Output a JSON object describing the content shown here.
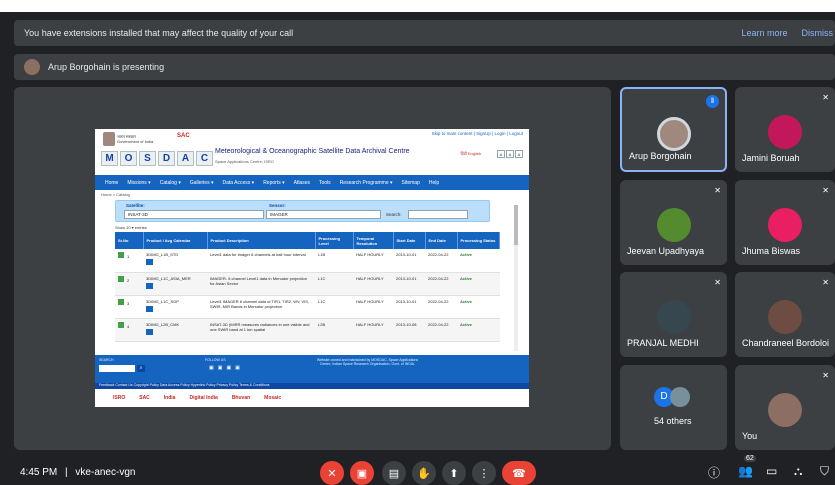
{
  "banner": {
    "text": "You have extensions installed that may affect the quality of your call",
    "learn_more": "Learn more",
    "dismiss": "Dismiss"
  },
  "presenting": {
    "text": "Arup Borgohain is presenting"
  },
  "mosdac": {
    "goi_hindi": "भारत सरकार",
    "goi": "Government of India",
    "sac": "SAC",
    "letters": [
      "M",
      "O",
      "S",
      "D",
      "A",
      "C"
    ],
    "title": "Meteorological & Oceanographic Satellite Data Archival Centre",
    "subtitle": "Space Applications Centre, ISRO",
    "skip": "Skip to main content | SignUp | Login | Logout",
    "lang": "हिंदी  English",
    "nav": [
      "Home",
      "Missions ▾",
      "Catalog ▾",
      "Galleries ▾",
      "Data Access ▾",
      "Reports ▾",
      "Atlases",
      "Tools",
      "Research Programme ▾",
      "Sitemap",
      "Help"
    ],
    "breadcrumb": "Home » Catalog",
    "satellite_label": "Satellite:",
    "satellite_value": "INSAT-3D",
    "sensor_label": "Sensor:",
    "sensor_value": "IMAGER",
    "search_label": "Search:",
    "show": "Show 10 ▾ entries",
    "columns": [
      "Sr.No",
      "Product / Avg Calendar",
      "Product Description",
      "Processing Level",
      "Temporal Resolution",
      "Start Date",
      "End Date",
      "Processing Status"
    ],
    "rows": [
      {
        "no": "1",
        "product": "3DIMG_L1B_STD",
        "desc": "Level1 data for Imager 6 channels at half hour interval",
        "level": "L1B",
        "temporal": "HALF HOURLY",
        "start": "2013-10-01",
        "end": "2022-04-22",
        "status": "Active"
      },
      {
        "no": "2",
        "product": "3DIMG_L1C_ASIA_MER",
        "desc": "IMAGER- 6 channel Level1 data in Mercator projection for Asian Sector",
        "level": "L1C",
        "temporal": "HALF HOURLY",
        "start": "2013-10-01",
        "end": "2022-04-22",
        "status": "Active"
      },
      {
        "no": "3",
        "product": "3DIMG_L1C_SGP",
        "desc": "Level1 IMAGER 6 channel data of TIR1, TIR2, WV, VIS, SWIR, MIR Bands in Mercator projection",
        "level": "L1C",
        "temporal": "HALF HOURLY",
        "start": "2013-10-01",
        "end": "2022-04-22",
        "status": "Active"
      },
      {
        "no": "4",
        "product": "3DIMG_L2B_CMK",
        "desc": "INSAT-3D (IMRR measures radiances in one visible and one SWIR band at 1 km spatial",
        "level": "L2B",
        "temporal": "HALF HOURLY",
        "start": "2013-10-08",
        "end": "2022-04-22",
        "status": "Active"
      }
    ],
    "footer_search": "SEARCH",
    "footer_follow": "FOLLOW US",
    "footer_site": "Website owned and maintained by MOSDAC, Space Applications Centre, Indian Space Research Organisation, Govt. of INDIA.",
    "footer_links": "Feedback   Contact Us   Copyright Policy   Data Access Policy   Hyperlink Policy   Privacy Policy   Terms & Conditions",
    "logos": [
      "ISRO",
      "SAC",
      "India",
      "Digital India",
      "Bhuvan",
      "Mosaic"
    ]
  },
  "participants": [
    {
      "name": "Arup Borgohain",
      "face_color": "#a1887f",
      "speaking": true
    },
    {
      "name": "Jamini Boruah",
      "face_color": "#c2185b",
      "muted": true
    },
    {
      "name": "Jeevan Upadhyaya",
      "face_color": "#558b2f",
      "muted": true
    },
    {
      "name": "Jhuma Biswas",
      "face_color": "#e91e63",
      "muted": true
    },
    {
      "name": "PRANJAL MEDHI",
      "face_color": "#37474f",
      "muted": true
    },
    {
      "name": "Chandraneel Bordoloi",
      "face_color": "#6d4c41",
      "muted": true
    },
    {
      "name": "54 others",
      "initial": "D"
    },
    {
      "name": "You",
      "face_color": "#8d6e63",
      "muted": true
    }
  ],
  "bottom": {
    "time": "4:45 PM",
    "meeting": "vke-anec-vgn",
    "people_count": "62"
  },
  "colors": {
    "stop": "#ea4335",
    "tile": "#3c4043",
    "accent": "#8ab4f8"
  }
}
